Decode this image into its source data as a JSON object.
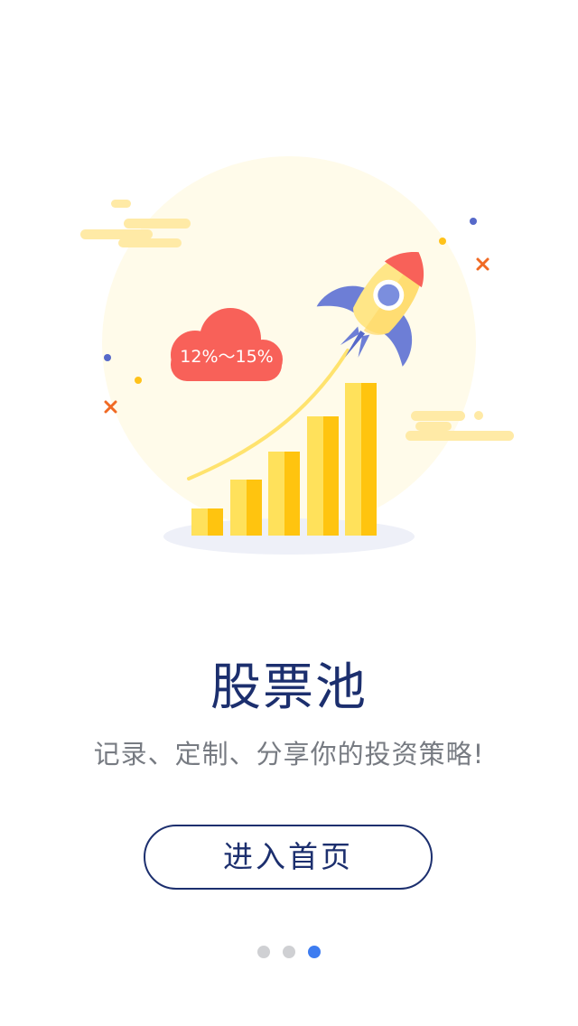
{
  "illustration": {
    "badge_text": "12%～15%",
    "colors": {
      "sun": "#fffbea",
      "bar_light": "#ffe15b",
      "bar_dark": "#ffc40f",
      "cloud": "#f86159",
      "rocket_body": "#ffe687",
      "rocket_window": "#7b8ede",
      "rocket_nose": "#f86159",
      "fins": "#6d7ed6",
      "trail": "#ffe36e",
      "shadow": "#eef0f8",
      "bg_clouds": "#ffeaa6",
      "spark_orange": "#f06a24",
      "spark_blue": "#5669c9",
      "spark_yellow": "#ffc21a"
    },
    "icon": "rocket-chart-icon"
  },
  "main": {
    "title": "股票池",
    "subtitle": "记录、定制、分享你的投资策略!",
    "enter_button": "进入首页"
  },
  "pager": {
    "count": 3,
    "active_index": 2,
    "active_color": "#3d7cf0",
    "inactive_color": "#cfd0d3"
  }
}
